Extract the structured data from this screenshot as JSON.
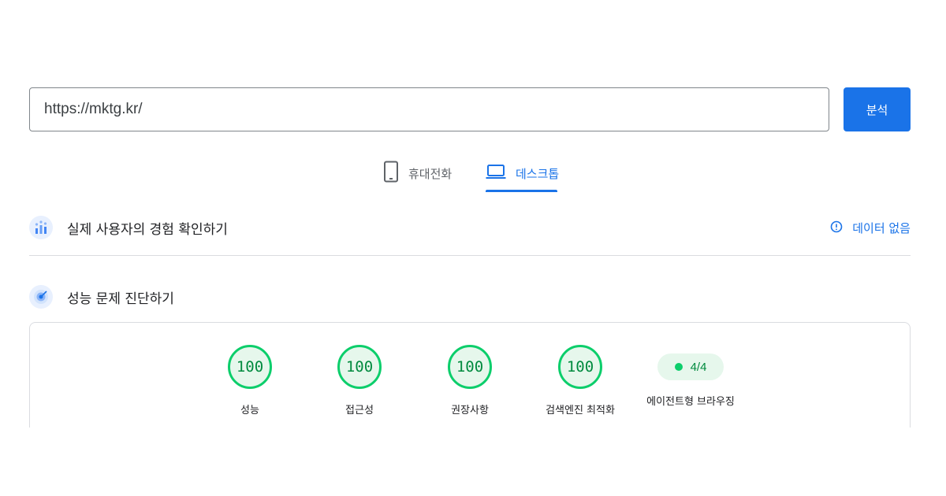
{
  "search": {
    "url_value": "https://mktg.kr/",
    "analyze_label": "분석"
  },
  "tabs": [
    {
      "label": "휴대전화",
      "icon": "smartphone-icon",
      "active": false
    },
    {
      "label": "데스크톱",
      "icon": "laptop-icon",
      "active": true
    }
  ],
  "field_data": {
    "title": "실제 사용자의 경험 확인하기",
    "icon": "bar-chart-icon",
    "status_label": "데이터 없음",
    "status_icon": "info-icon"
  },
  "diagnostics": {
    "title": "성능 문제 진단하기",
    "icon": "lighthouse-icon"
  },
  "scores": [
    {
      "value": "100",
      "label": "성능"
    },
    {
      "value": "100",
      "label": "접근성"
    },
    {
      "value": "100",
      "label": "권장사항"
    },
    {
      "value": "100",
      "label": "검색엔진 최적화"
    }
  ],
  "agentic": {
    "value": "4/4",
    "label": "에이전트형 브라우징"
  },
  "colors": {
    "accent": "#1a73e8",
    "pass": "#0cce6b",
    "pass_text": "#008a3e"
  }
}
